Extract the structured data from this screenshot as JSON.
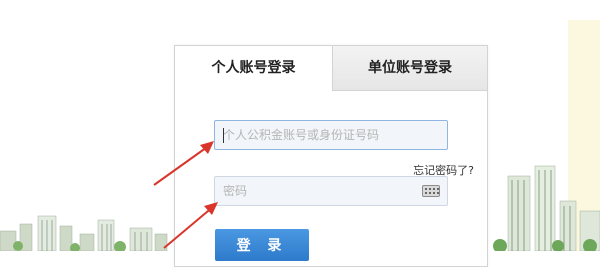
{
  "tabs": {
    "personal_label": "个人账号登录",
    "company_label": "单位账号登录"
  },
  "account_field": {
    "placeholder": "个人公积金账号或身份证号码",
    "value": ""
  },
  "forgot_password": "忘记密码了?",
  "password_field": {
    "placeholder": "密码",
    "value": ""
  },
  "login_button": "登 录",
  "colors": {
    "annotation_arrow": "#d9352b",
    "login_button": "#3a8bdc",
    "field_border": "#8fb6e2",
    "side_panel": "#fbf8df"
  },
  "icons": [
    "keyboard-icon",
    "annotation-arrow"
  ]
}
